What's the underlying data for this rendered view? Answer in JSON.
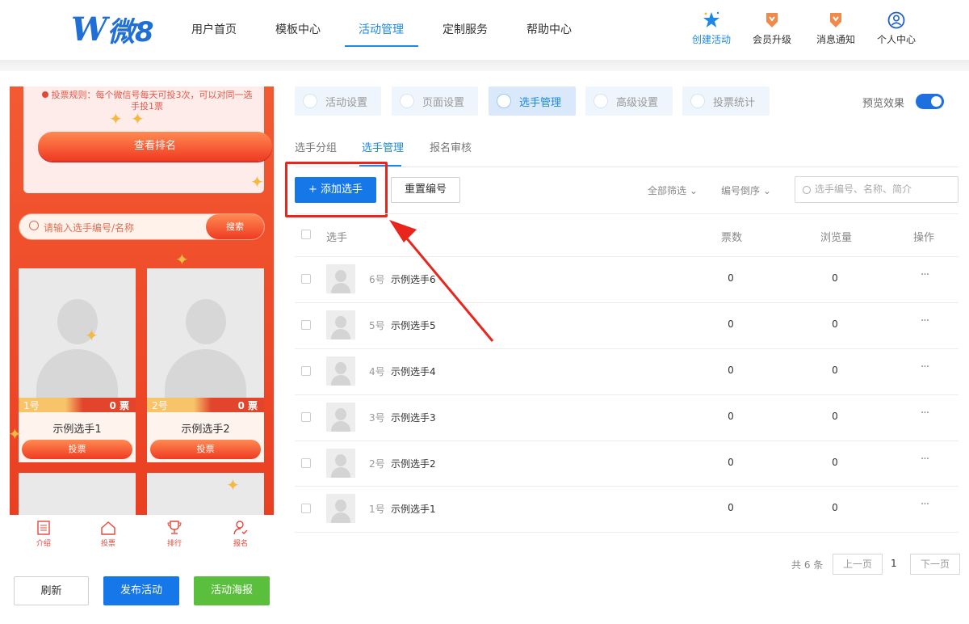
{
  "brand": {
    "logo_w": "W",
    "logo_text": "微8"
  },
  "nav": {
    "items": [
      "用户首页",
      "模板中心",
      "活动管理",
      "定制服务",
      "帮助中心"
    ],
    "active_index": 2
  },
  "tools": [
    {
      "label": "创建活动",
      "icon": "star-icon"
    },
    {
      "label": "会员升级",
      "icon": "badge-icon"
    },
    {
      "label": "消息通知",
      "icon": "bell-badge-icon"
    },
    {
      "label": "个人中心",
      "icon": "user-circle-icon"
    }
  ],
  "preview": {
    "rule_text": "投票规则：每个微信号每天可投3次，可以对同一选手投1票",
    "rank_button": "查看排名",
    "search_placeholder": "请输入选手编号/名称",
    "search_button": "搜索",
    "cards": [
      {
        "no": "1号",
        "votes": "0 票",
        "name": "示例选手1",
        "vote_button": "投票"
      },
      {
        "no": "2号",
        "votes": "0 票",
        "name": "示例选手2",
        "vote_button": "投票"
      }
    ],
    "tabbar": [
      "介绍",
      "投票",
      "排行",
      "报名"
    ],
    "buttons": {
      "refresh": "刷新",
      "publish": "发布活动",
      "poster": "活动海报"
    }
  },
  "steps": {
    "items": [
      "活动设置",
      "页面设置",
      "选手管理",
      "高级设置",
      "投票统计"
    ],
    "active_index": 2,
    "preview_label": "预览效果",
    "preview_on": true
  },
  "subtabs": {
    "items": [
      "选手分组",
      "选手管理",
      "报名审核"
    ],
    "active_index": 1
  },
  "toolbar": {
    "add_button": "+ 添加选手",
    "reset_button": "重置编号",
    "filter_all": "全部筛选",
    "sort": "编号倒序",
    "search_placeholder": "选手编号、名称、简介"
  },
  "table": {
    "headers": {
      "player": "选手",
      "votes": "票数",
      "views": "浏览量",
      "actions": "操作"
    },
    "rows": [
      {
        "no": "6号",
        "name": "示例选手6",
        "votes": "0",
        "views": "0",
        "more": "···"
      },
      {
        "no": "5号",
        "name": "示例选手5",
        "votes": "0",
        "views": "0",
        "more": "···"
      },
      {
        "no": "4号",
        "name": "示例选手4",
        "votes": "0",
        "views": "0",
        "more": "···"
      },
      {
        "no": "3号",
        "name": "示例选手3",
        "votes": "0",
        "views": "0",
        "more": "···"
      },
      {
        "no": "2号",
        "name": "示例选手2",
        "votes": "0",
        "views": "0",
        "more": "···"
      },
      {
        "no": "1号",
        "name": "示例选手1",
        "votes": "0",
        "views": "0",
        "more": "···"
      }
    ]
  },
  "pagination": {
    "total": "共 6 条",
    "prev": "上一页",
    "current": "1",
    "next": "下一页"
  },
  "colors": {
    "accent": "#1e88e5",
    "primary_button": "#1677e8",
    "annotation": "#e8261d",
    "poster_button": "#5bbf3e"
  }
}
